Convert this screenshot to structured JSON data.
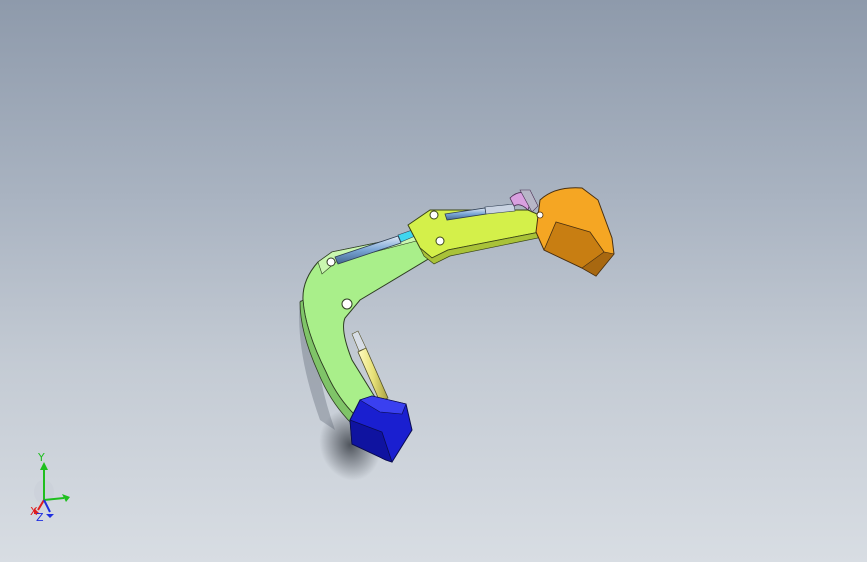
{
  "viewport": {
    "background_top": "#8e9aab",
    "background_bottom": "#d8dde3"
  },
  "model": {
    "parts": [
      {
        "name": "base-swivel",
        "color": "#1a1fd0"
      },
      {
        "name": "boom",
        "color": "#a9ef8a"
      },
      {
        "name": "boom-cylinder",
        "color": "#e8e27a"
      },
      {
        "name": "arm-cylinder",
        "color": "#7aa6d6"
      },
      {
        "name": "stick",
        "color": "#d4f04a"
      },
      {
        "name": "bucket-cylinder",
        "color": "#b6c3d6"
      },
      {
        "name": "bucket-link",
        "color": "#d9a0e0"
      },
      {
        "name": "bucket",
        "color": "#f5a623"
      }
    ]
  },
  "triad": {
    "y_label": "Y",
    "x_label": "X",
    "z_label": "Z",
    "y_color": "#1fbf1f",
    "x_color": "#e01f1f",
    "z_color": "#1f2fe0"
  }
}
